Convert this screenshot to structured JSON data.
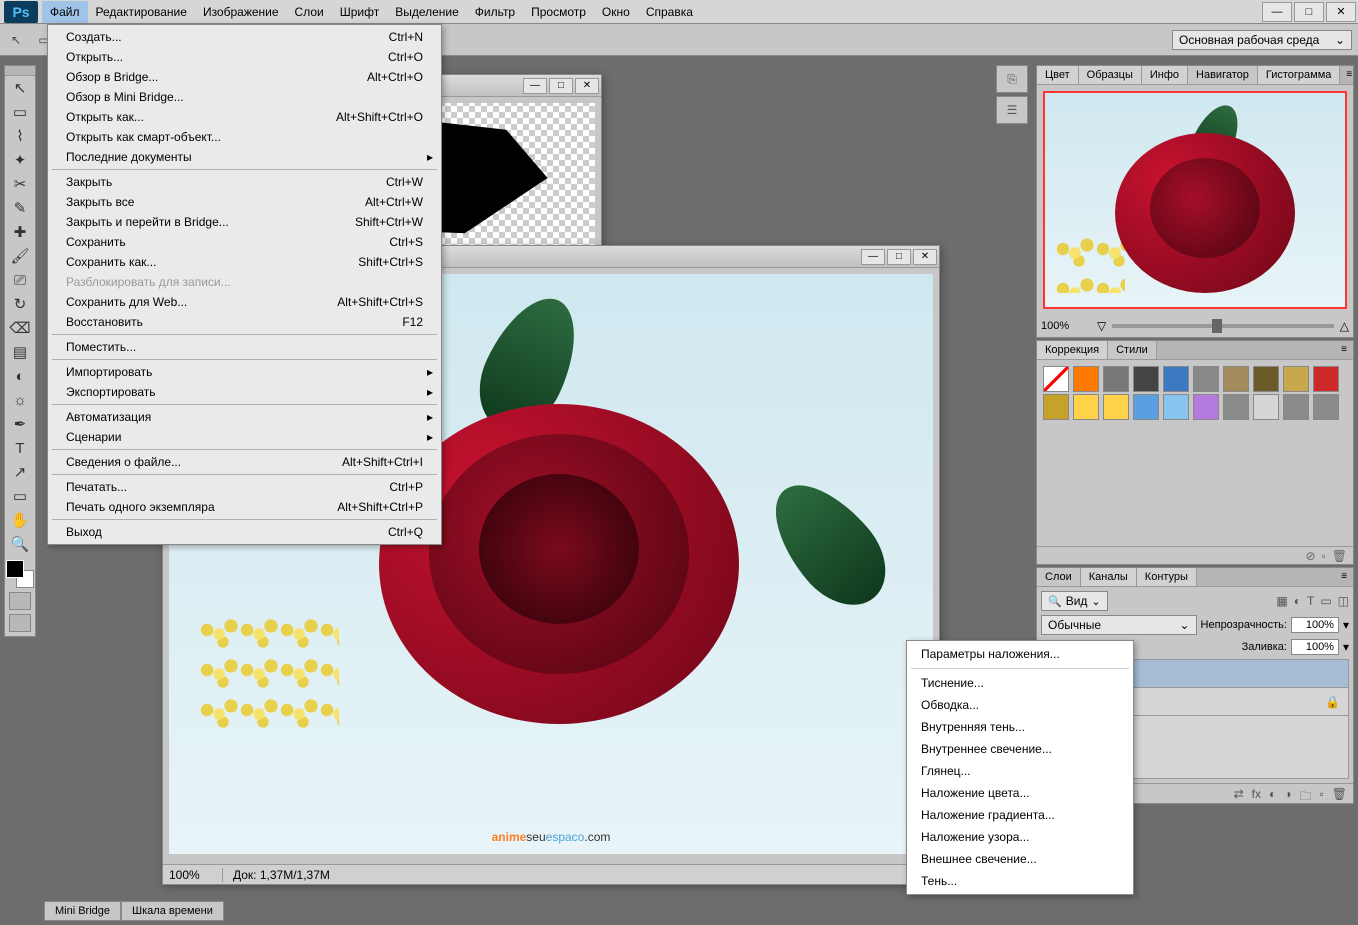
{
  "menubar": {
    "items": [
      "Файл",
      "Редактирование",
      "Изображение",
      "Слои",
      "Шрифт",
      "Выделение",
      "Фильтр",
      "Просмотр",
      "Окно",
      "Справка"
    ],
    "logo": "Ps"
  },
  "workspace_dropdown": "Основная рабочая среда",
  "file_menu": [
    {
      "label": "Создать...",
      "shortcut": "Ctrl+N"
    },
    {
      "label": "Открыть...",
      "shortcut": "Ctrl+O"
    },
    {
      "label": "Обзор в Bridge...",
      "shortcut": "Alt+Ctrl+O"
    },
    {
      "label": "Обзор в Mini Bridge..."
    },
    {
      "label": "Открыть как...",
      "shortcut": "Alt+Shift+Ctrl+O"
    },
    {
      "label": "Открыть как смарт-объект..."
    },
    {
      "label": "Последние документы",
      "arrow": true
    },
    {
      "sep": true
    },
    {
      "label": "Закрыть",
      "shortcut": "Ctrl+W"
    },
    {
      "label": "Закрыть все",
      "shortcut": "Alt+Ctrl+W"
    },
    {
      "label": "Закрыть и перейти в Bridge...",
      "shortcut": "Shift+Ctrl+W"
    },
    {
      "label": "Сохранить",
      "shortcut": "Ctrl+S"
    },
    {
      "label": "Сохранить как...",
      "shortcut": "Shift+Ctrl+S"
    },
    {
      "label": "Разблокировать для записи...",
      "disabled": true
    },
    {
      "label": "Сохранить для Web...",
      "shortcut": "Alt+Shift+Ctrl+S"
    },
    {
      "label": "Восстановить",
      "shortcut": "F12"
    },
    {
      "sep": true
    },
    {
      "label": "Поместить..."
    },
    {
      "sep": true
    },
    {
      "label": "Импортировать",
      "arrow": true
    },
    {
      "label": "Экспортировать",
      "arrow": true
    },
    {
      "sep": true
    },
    {
      "label": "Автоматизация",
      "arrow": true
    },
    {
      "label": "Сценарии",
      "arrow": true
    },
    {
      "sep": true
    },
    {
      "label": "Сведения о файле...",
      "shortcut": "Alt+Shift+Ctrl+I"
    },
    {
      "sep": true
    },
    {
      "label": "Печатать...",
      "shortcut": "Ctrl+P"
    },
    {
      "label": "Печать одного экземпляра",
      "shortcut": "Alt+Shift+Ctrl+P"
    },
    {
      "sep": true
    },
    {
      "label": "Выход",
      "shortcut": "Ctrl+Q"
    }
  ],
  "fx_menu": [
    "Параметры наложения...",
    "",
    "Тиснение...",
    "Обводка...",
    "Внутренняя тень...",
    "Внутреннее свечение...",
    "Глянец...",
    "Наложение цвета...",
    "Наложение градиента...",
    "Наложение узора...",
    "Внешнее свечение...",
    "Тень..."
  ],
  "doc2": {
    "zoom": "100%",
    "docinfo": "Док: 1,37M/1,37M",
    "watermark": {
      "a": "anime",
      "b": "seu",
      "c": "espaco",
      "d": ".com"
    }
  },
  "panels": {
    "nav_tabs": [
      "Цвет",
      "Образцы",
      "Инфо",
      "Навигатор",
      "Гистограмма"
    ],
    "nav_zoom": "100%",
    "styles_tabs": [
      "Коррекция",
      "Стили"
    ],
    "layers_tabs": [
      "Слои",
      "Каналы",
      "Контуры"
    ],
    "layers_kind": "Вид",
    "layers_blend": "Обычные",
    "opacity_label": "Непрозрачность:",
    "opacity_val": "100%",
    "fill_label": "Заливка:",
    "fill_val": "100%"
  },
  "bottom_tabs": [
    "Mini Bridge",
    "Шкала времени"
  ],
  "style_colors": [
    "#fff",
    "#ff7a00",
    "#777",
    "#444",
    "#3a78c2",
    "#888",
    "#a38b5b",
    "#6b5a2a",
    "#c7a84b",
    "#cc2a2a",
    "#c7a22a",
    "#ffd24a",
    "#ffd24a",
    "#5aa0e0",
    "#87c5ef",
    "#b47ae0",
    "#8b8b8b",
    "#d6d6d6",
    "#8b8b8b",
    "#8b8b8b"
  ]
}
